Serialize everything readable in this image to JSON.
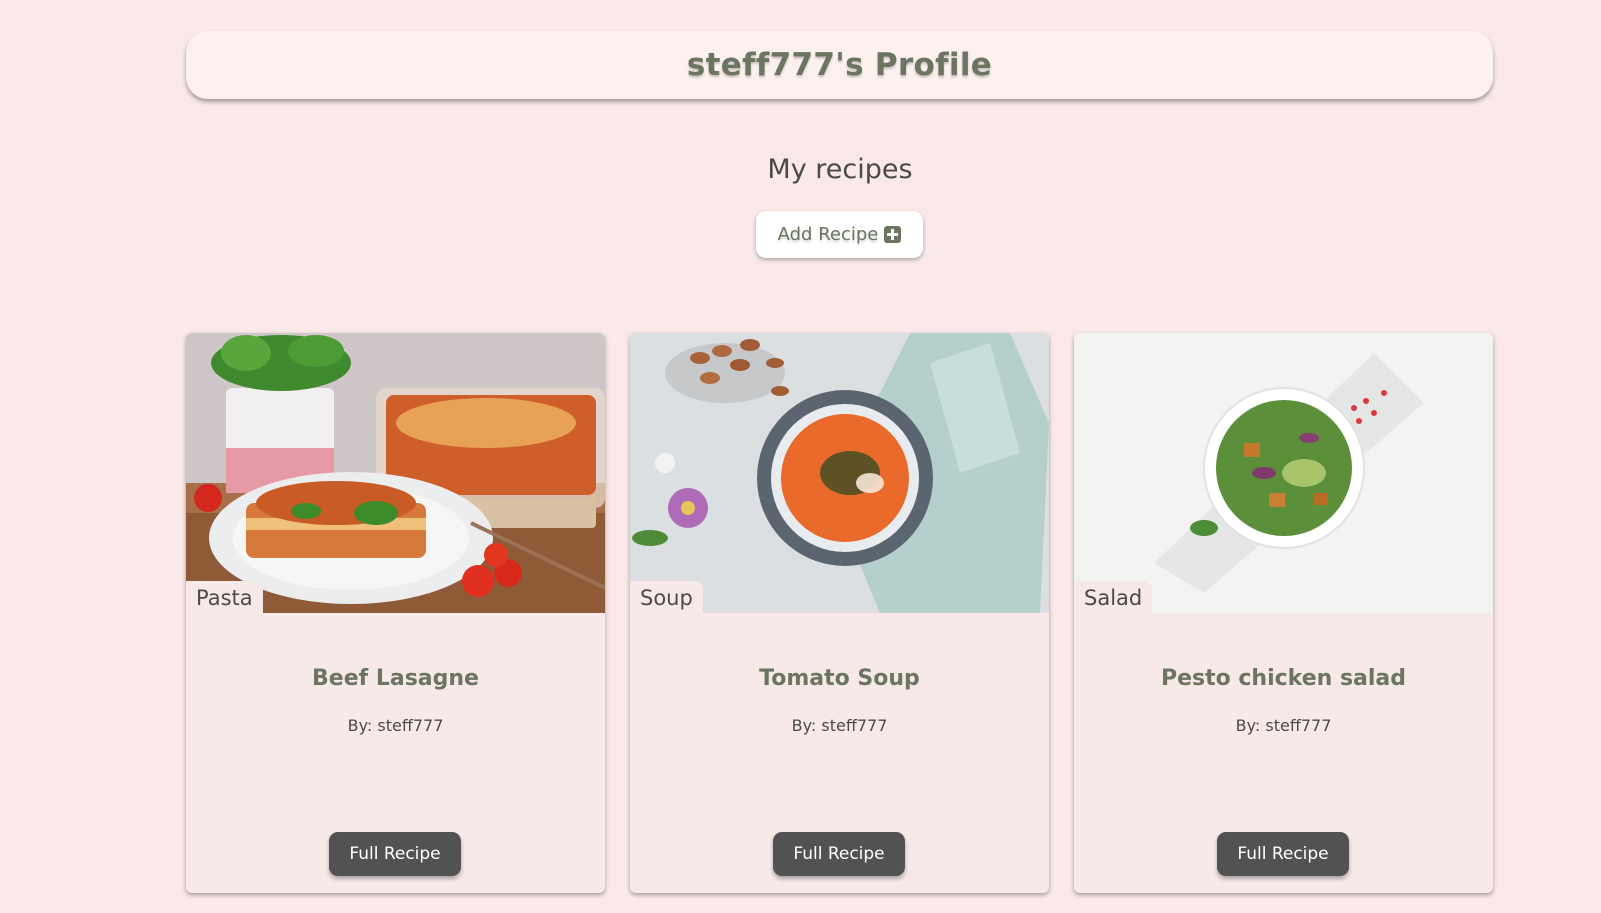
{
  "header": {
    "title": "steff777's Profile"
  },
  "section": {
    "title": "My recipes",
    "add_button_label": "Add Recipe"
  },
  "recipes": [
    {
      "category": "Pasta",
      "title": "Beef Lasagne",
      "author": "By: steff777",
      "button_label": "Full Recipe"
    },
    {
      "category": "Soup",
      "title": "Tomato Soup",
      "author": "By: steff777",
      "button_label": "Full Recipe"
    },
    {
      "category": "Salad",
      "title": "Pesto chicken salad",
      "author": "By: steff777",
      "button_label": "Full Recipe"
    }
  ],
  "colors": {
    "page_background": "#fbe9e9",
    "accent_text": "#6b7560",
    "button_dark": "#525252"
  }
}
